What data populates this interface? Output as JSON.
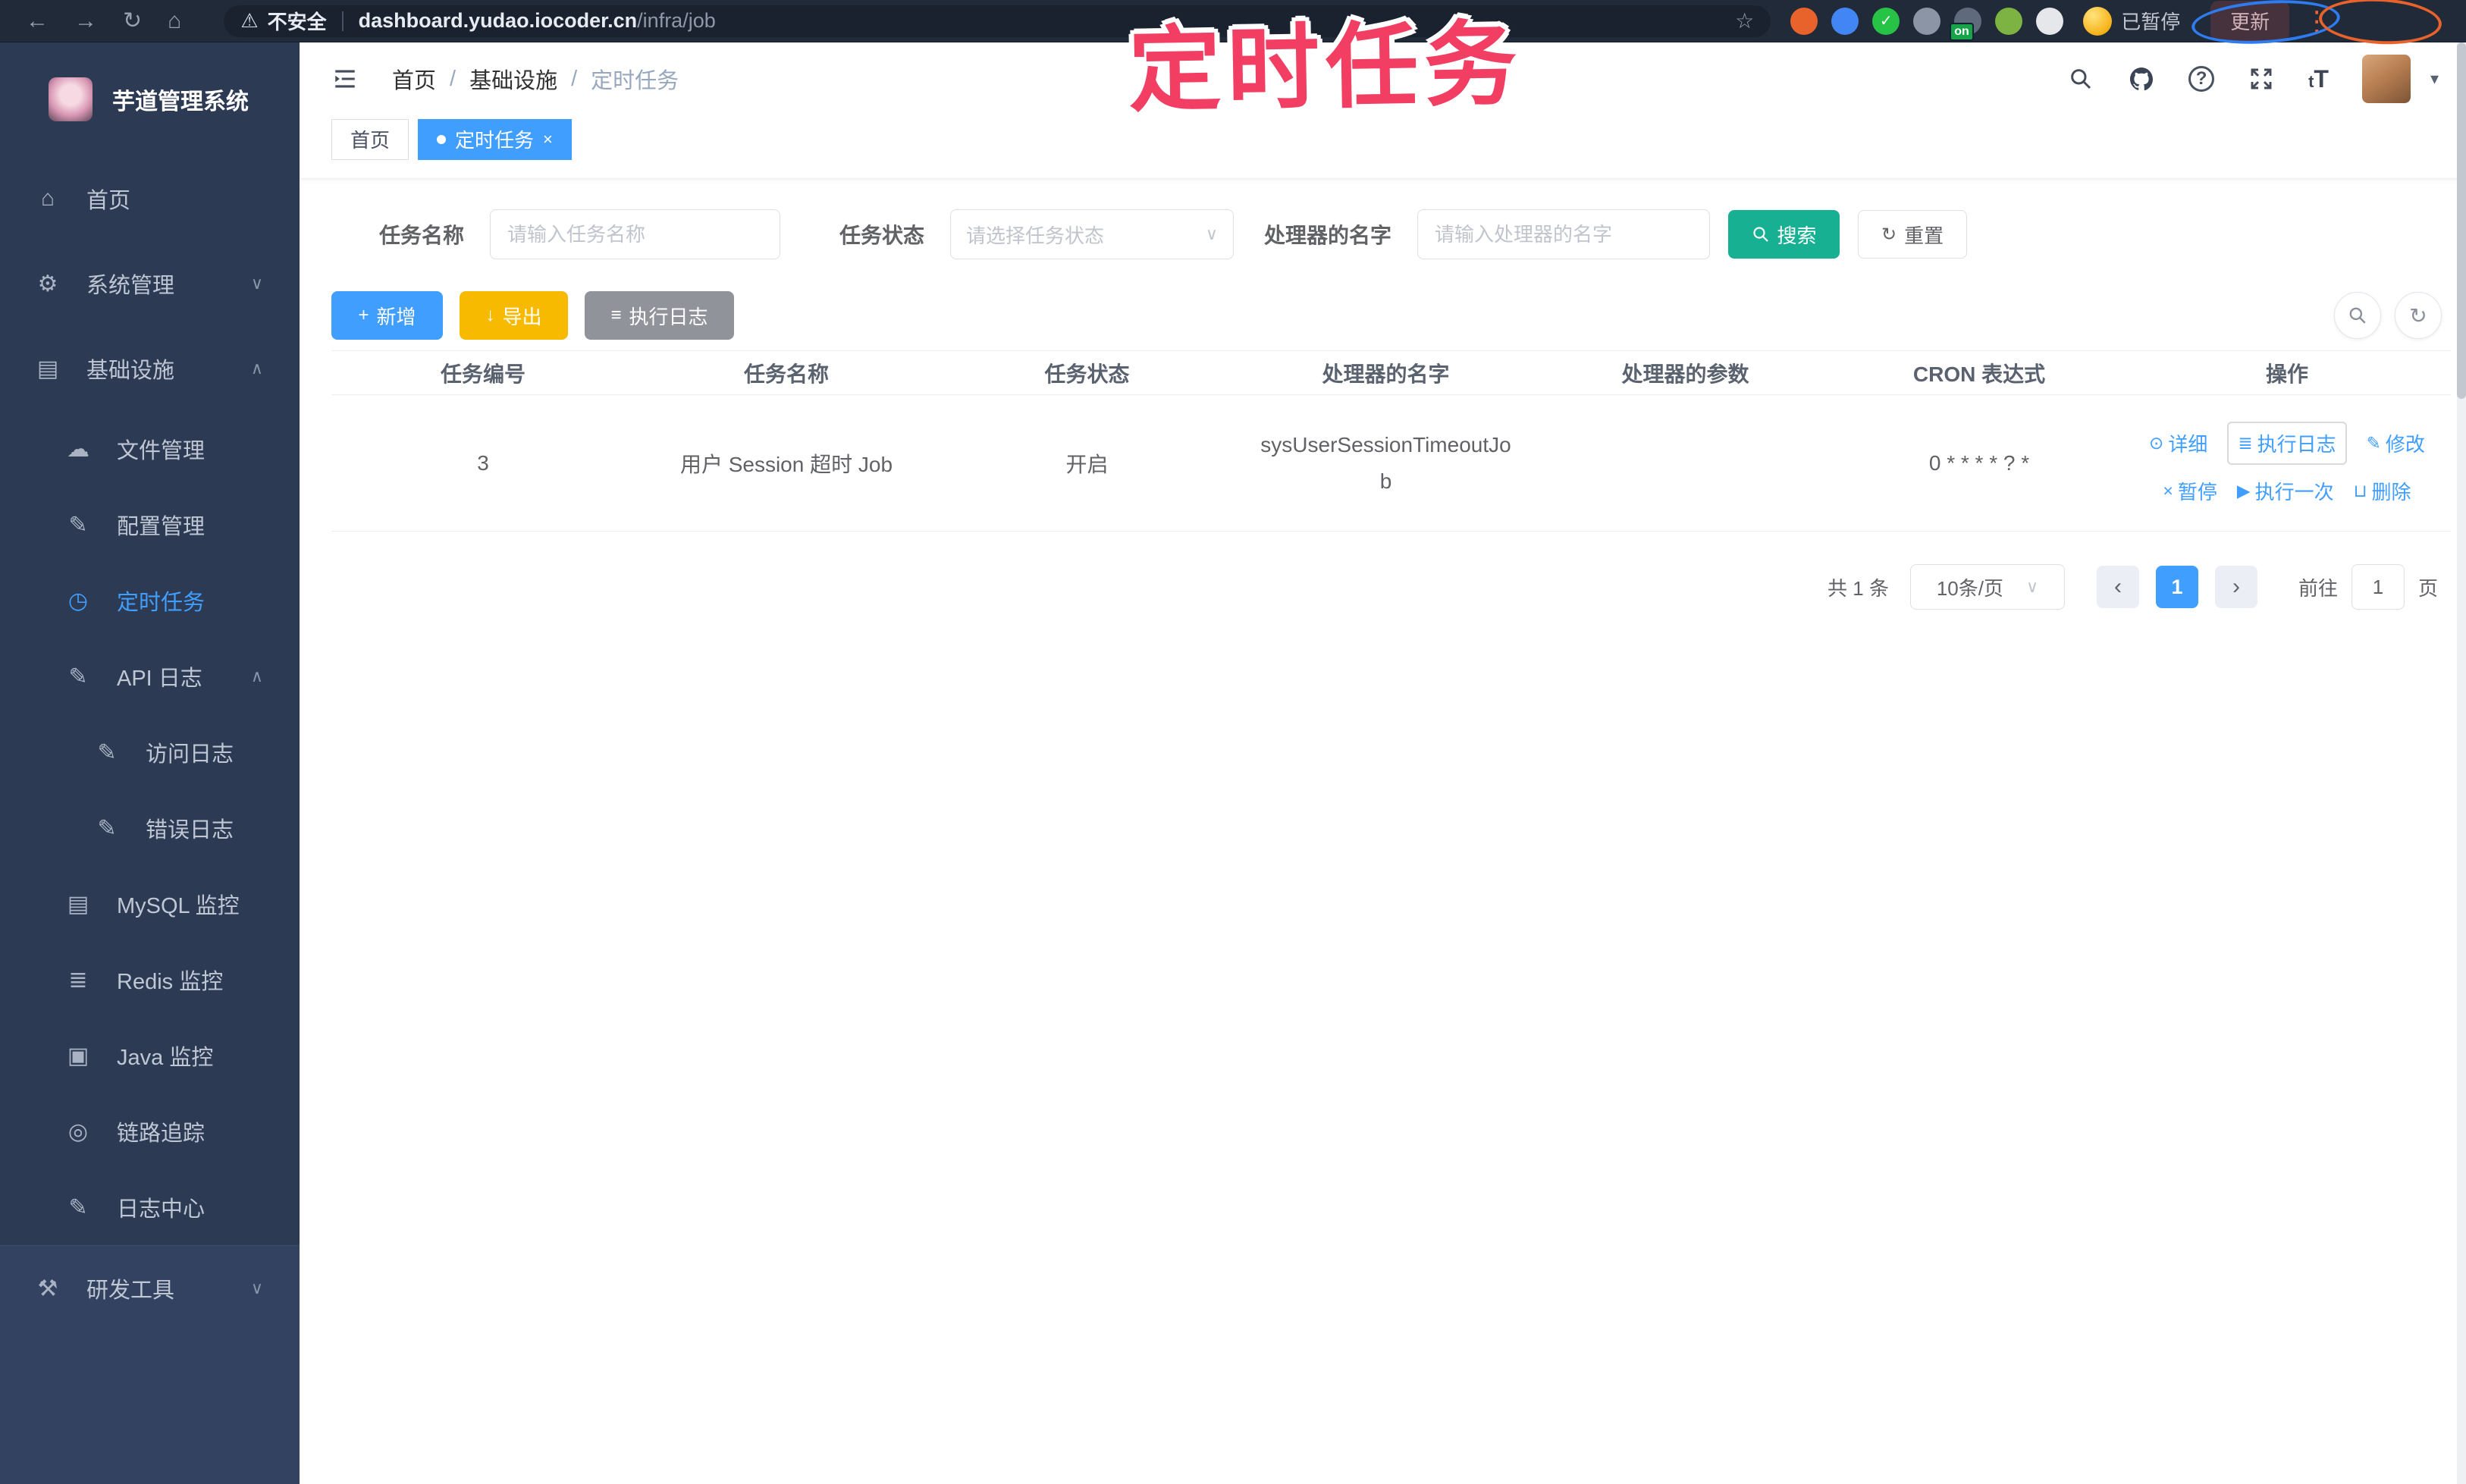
{
  "browser": {
    "security_label": "不安全",
    "url_host": "dashboard.yudao.iocoder.cn",
    "url_path": "/infra/job",
    "paused_label": "已暂停",
    "update_label": "更新",
    "extensions": [
      {
        "name": "ext-orange-icon",
        "color": "#e8622c",
        "glyph": ""
      },
      {
        "name": "ext-blue-icon",
        "color": "#4285f4",
        "glyph": ""
      },
      {
        "name": "ext-green-check-icon",
        "color": "#27c346",
        "glyph": "✓"
      },
      {
        "name": "ext-grid-icon",
        "color": "#8b95a5",
        "glyph": ""
      },
      {
        "name": "ext-list-icon",
        "color": "#5f6b7d",
        "glyph": "",
        "badge": "on",
        "badge_color": "#16a34a"
      },
      {
        "name": "ext-leaf-icon",
        "color": "#7cb342",
        "glyph": ""
      },
      {
        "name": "ext-puzzle-icon",
        "color": "#e5e7eb",
        "glyph": ""
      }
    ]
  },
  "annotation": {
    "text": "定时任务",
    "color": "#f23e62"
  },
  "sidebar": {
    "logo_title": "芋道管理系统",
    "items": [
      {
        "label": "首页",
        "icon": "home-icon",
        "level": 1
      },
      {
        "label": "系统管理",
        "icon": "gear-icon",
        "level": 1,
        "chevron": "down"
      },
      {
        "label": "基础设施",
        "icon": "infra-icon",
        "level": 1,
        "chevron": "up"
      },
      {
        "label": "文件管理",
        "icon": "cloud-upload-icon",
        "level": 2
      },
      {
        "label": "配置管理",
        "icon": "edit-square-icon",
        "level": 2
      },
      {
        "label": "定时任务",
        "icon": "timer-icon",
        "level": 2,
        "active": true
      },
      {
        "label": "API 日志",
        "icon": "api-log-icon",
        "level": 2,
        "chevron": "up"
      },
      {
        "label": "访问日志",
        "icon": "access-log-icon",
        "level": 3
      },
      {
        "label": "错误日志",
        "icon": "error-log-icon",
        "level": 3
      },
      {
        "label": "MySQL 监控",
        "icon": "mysql-icon",
        "level": 2
      },
      {
        "label": "Redis 监控",
        "icon": "redis-icon",
        "level": 2
      },
      {
        "label": "Java 监控",
        "icon": "java-icon",
        "level": 2
      },
      {
        "label": "链路追踪",
        "icon": "trace-eye-icon",
        "level": 2
      },
      {
        "label": "日志中心",
        "icon": "log-center-icon",
        "level": 2
      },
      {
        "label": "研发工具",
        "icon": "toolbox-icon",
        "level": 1,
        "chevron": "down",
        "section": true
      }
    ]
  },
  "header": {
    "breadcrumb": [
      "首页",
      "基础设施",
      "定时任务"
    ]
  },
  "tabs": [
    {
      "label": "首页",
      "active": false,
      "closable": false
    },
    {
      "label": "定时任务",
      "active": true,
      "closable": true
    }
  ],
  "filters": {
    "fields": [
      {
        "label": "任务名称",
        "placeholder": "请输入任务名称",
        "type": "input"
      },
      {
        "label": "任务状态",
        "placeholder": "请选择任务状态",
        "type": "select"
      },
      {
        "label": "处理器的名字",
        "placeholder": "请输入处理器的名字",
        "type": "input"
      }
    ],
    "search_label": "搜索",
    "reset_label": "重置"
  },
  "toolbar": {
    "buttons": [
      {
        "label": "新增",
        "icon": "plus-icon",
        "type": "primary"
      },
      {
        "label": "导出",
        "icon": "download-icon",
        "type": "warning"
      },
      {
        "label": "执行日志",
        "icon": "list-icon",
        "type": "info"
      }
    ]
  },
  "table": {
    "columns": [
      "任务编号",
      "任务名称",
      "任务状态",
      "处理器的名字",
      "处理器的参数",
      "CRON 表达式",
      "操作"
    ],
    "rows": [
      {
        "id": "3",
        "name": "用户 Session 超时 Job",
        "status": "开启",
        "handler": "sysUserSessionTimeoutJob",
        "params": "",
        "cron": "0 * * * * ? *",
        "actions": [
          {
            "label": "详细",
            "icon": "view-icon"
          },
          {
            "label": "执行日志",
            "icon": "log-icon",
            "focused": true
          },
          {
            "label": "修改",
            "icon": "edit-icon"
          },
          {
            "label": "暂停",
            "icon": "pause-icon"
          },
          {
            "label": "执行一次",
            "icon": "run-icon"
          },
          {
            "label": "删除",
            "icon": "trash-icon"
          }
        ]
      }
    ]
  },
  "pagination": {
    "total": "共 1 条",
    "page_size": "10条/页",
    "pages": [
      "1"
    ],
    "current": "1",
    "goto_label": "前往",
    "goto_value": "1",
    "unit_label": "页"
  },
  "colors": {
    "accent_blue": "#409eff",
    "search_teal": "#18b092",
    "export_yellow": "#f8ba00",
    "info_gray": "#909399",
    "sidebar_bg": "#2d3a54",
    "annotation_pink": "#f23e62"
  }
}
